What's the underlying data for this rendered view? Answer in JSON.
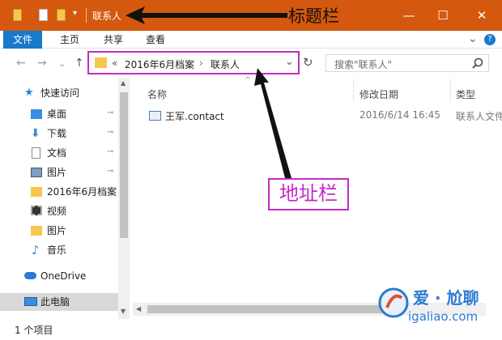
{
  "window": {
    "title": "联系人",
    "annotation": "标题栏",
    "minimize_glyph": "—",
    "maximize_glyph": "☐",
    "close_glyph": "✕"
  },
  "ribbon": {
    "tabs": [
      "文件",
      "主页",
      "共享",
      "查看"
    ],
    "expand_glyph": "⌄",
    "help_glyph": "?"
  },
  "nav": {
    "back_glyph": "←",
    "forward_glyph": "→",
    "recent_glyph": "⌄",
    "up_glyph": "↑",
    "refresh_glyph": "↻",
    "address": {
      "overflow": "«",
      "segments": [
        "2016年6月档案",
        "联系人"
      ],
      "separator": "›",
      "dropdown_glyph": "⌄"
    },
    "search": {
      "placeholder": "搜索\"联系人\""
    }
  },
  "sidebar": {
    "items": [
      {
        "label": "快速访问",
        "icon": "star-icon",
        "pinned": false
      },
      {
        "label": "桌面",
        "icon": "desktop-icon",
        "pinned": true
      },
      {
        "label": "下载",
        "icon": "download-icon",
        "pinned": true
      },
      {
        "label": "文档",
        "icon": "document-icon",
        "pinned": true
      },
      {
        "label": "图片",
        "icon": "pictures-icon",
        "pinned": true
      },
      {
        "label": "2016年6月档案",
        "icon": "folder-icon",
        "pinned": false
      },
      {
        "label": "视频",
        "icon": "video-icon",
        "pinned": false
      },
      {
        "label": "图片",
        "icon": "folder-icon",
        "pinned": false
      },
      {
        "label": "音乐",
        "icon": "music-icon",
        "pinned": false
      },
      {
        "label": "OneDrive",
        "icon": "cloud-icon",
        "pinned": false
      },
      {
        "label": "此电脑",
        "icon": "computer-icon",
        "pinned": false
      }
    ],
    "pin_glyph": "⊸"
  },
  "content": {
    "columns": [
      "名称",
      "修改日期",
      "类型"
    ],
    "sort_glyph": "^",
    "rows": [
      {
        "name": "王军.contact",
        "modified": "2016/6/14 16:45",
        "type": "联系人文件"
      }
    ]
  },
  "status": {
    "text": "1 个项目"
  },
  "annotations": {
    "address_bar": "地址栏"
  },
  "watermark": {
    "line1": "爱 · 尬聊",
    "line2": "igaliao.com"
  }
}
